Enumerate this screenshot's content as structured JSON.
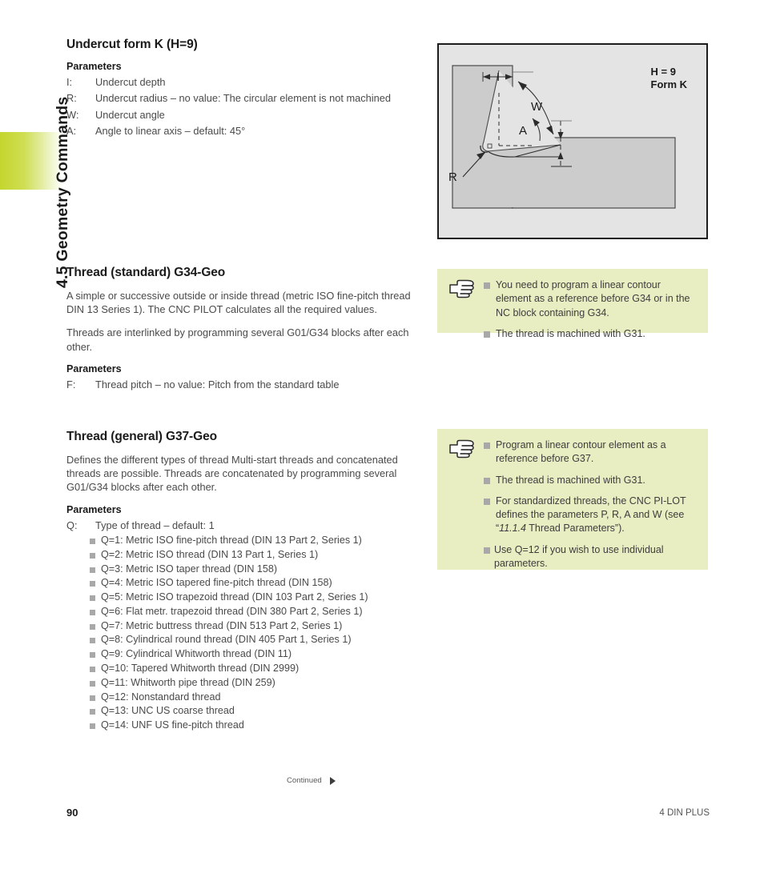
{
  "chapter": {
    "tab_label": "4.5 Geometry Commands"
  },
  "figure": {
    "caption_line1": "H = 9",
    "caption_line2": "Form K",
    "labels": {
      "depth": "I",
      "radius": "R",
      "angle_w": "W",
      "angle_a": "A"
    }
  },
  "undercut": {
    "heading": "Undercut form K (H=9)",
    "parameters_heading": "Parameters",
    "parameters": [
      {
        "key": "I:",
        "desc": "Undercut depth"
      },
      {
        "key": "R:",
        "desc": "Undercut radius – no value: The circular element is not machined"
      },
      {
        "key": "W:",
        "desc": "Undercut angle"
      },
      {
        "key": "A:",
        "desc": "Angle to linear axis – default: 45°"
      }
    ]
  },
  "g34": {
    "heading": "Thread (standard) G34-Geo",
    "paragraphs": [
      "A simple or successive outside or inside thread (metric ISO fine-pitch thread DIN 13 Series 1). The CNC PILOT calculates all the required values.",
      "Threads are interlinked by programming several G01/G34 blocks after each other."
    ],
    "parameters_heading": "Parameters",
    "parameters": [
      {
        "key": "F:",
        "desc": "Thread pitch – no value: Pitch from the standard table"
      }
    ],
    "note": {
      "icon": "pointing-hand-icon",
      "items": [
        "You need to program a linear contour element as a reference before G34 or in the NC block containing G34.",
        "The thread is machined with G31."
      ]
    }
  },
  "g37": {
    "heading": "Thread (general) G37-Geo",
    "paragraphs": [
      "Defines the different types of thread Multi-start threads and concatenated threads are possible. Threads are concatenated by programming several G01/G34 blocks after each other."
    ],
    "parameters_heading": "Parameters",
    "q_param": {
      "key": "Q:",
      "desc": "Type of thread – default: 1"
    },
    "q_options": [
      "Q=1: Metric ISO fine-pitch thread (DIN 13 Part 2, Series 1)",
      "Q=2: Metric ISO thread (DIN 13 Part 1, Series 1)",
      "Q=3: Metric ISO taper thread (DIN 158)",
      "Q=4: Metric ISO tapered fine-pitch thread (DIN 158)",
      "Q=5: Metric ISO trapezoid thread (DIN 103 Part 2, Series 1)",
      "Q=6: Flat metr. trapezoid thread (DIN 380 Part 2, Series 1)",
      "Q=7: Metric buttress thread (DIN 513 Part 2, Series 1)",
      "Q=8: Cylindrical round thread (DIN 405 Part 1, Series 1)",
      "Q=9: Cylindrical Whitworth thread (DIN 11)",
      "Q=10: Tapered Whitworth thread (DIN 2999)",
      "Q=11: Whitworth pipe thread (DIN 259)",
      "Q=12: Nonstandard thread",
      "Q=13: UNC US coarse thread",
      "Q=14: UNF US fine-pitch thread"
    ],
    "note": {
      "icon": "pointing-hand-icon",
      "item1": "Program a linear contour element as a reference before G37.",
      "item2": "The thread is machined with G31.",
      "item3_before": "For standardized threads, the CNC PI-LOT defines the parameters P, R, A and W (see “",
      "item3_italic": "11.1.4",
      "item3_after": " Thread Parameters”).",
      "item4": "Use Q=12 if you wish to use individual parameters."
    }
  },
  "footer": {
    "continued_label": "Continued",
    "page_number": "90",
    "section_label": "4 DIN PLUS"
  },
  "colors": {
    "tab_green": "#c4d62e",
    "note_bg": "#e9eec2",
    "figure_bg": "#e4e4e4",
    "workpiece": "#cccccc"
  }
}
